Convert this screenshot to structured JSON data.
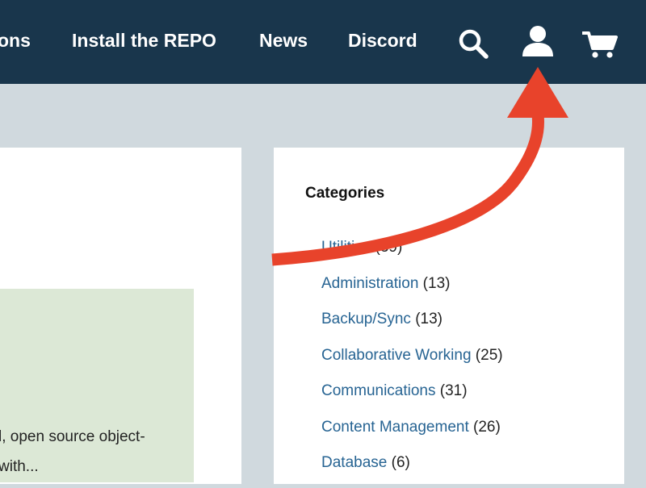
{
  "nav": {
    "items": [
      {
        "label": "ons"
      },
      {
        "label": "Install the REPO"
      },
      {
        "label": "News"
      },
      {
        "label": "Discord"
      }
    ],
    "icons": {
      "search": "search-icon",
      "account": "user-icon",
      "cart": "cart-icon"
    }
  },
  "excerpt": {
    "lines": [
      "l, open source object-",
      "with..."
    ]
  },
  "sidebar": {
    "heading": "Categories",
    "categories": [
      {
        "name": "Utilities",
        "count": "(39)"
      },
      {
        "name": "Administration",
        "count": "(13)"
      },
      {
        "name": "Backup/Sync",
        "count": "(13)"
      },
      {
        "name": "Collaborative Working",
        "count": "(25)"
      },
      {
        "name": "Communications",
        "count": "(31)"
      },
      {
        "name": "Content Management",
        "count": "(26)"
      },
      {
        "name": "Database",
        "count": "(6)"
      }
    ]
  },
  "colors": {
    "nav_bg": "#19364c",
    "page_bg": "#d0d9de",
    "link": "#276493",
    "excerpt_bg": "#dce8d6",
    "arrow": "#e8432b"
  }
}
